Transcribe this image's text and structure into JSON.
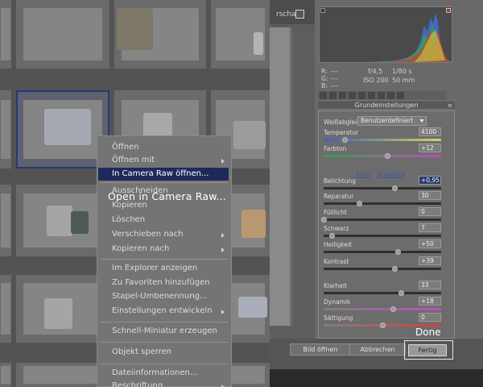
{
  "context_menu": {
    "items": [
      {
        "label": "Öffnen",
        "has_submenu": false
      },
      {
        "label": "Öffnen mit",
        "has_submenu": true
      },
      {
        "label": "In Camera Raw öffnen...",
        "has_submenu": false,
        "highlighted": true
      },
      {
        "label": "Ausschneiden",
        "has_submenu": false
      },
      {
        "label": "Kopieren",
        "has_submenu": false
      },
      {
        "label": "Löschen",
        "has_submenu": false
      },
      {
        "label": "Verschieben nach",
        "has_submenu": true
      },
      {
        "label": "Kopieren nach",
        "has_submenu": true
      },
      {
        "label": "Im Explorer anzeigen",
        "has_submenu": false
      },
      {
        "label": "Zu Favoriten hinzufügen",
        "has_submenu": false
      },
      {
        "label": "Stapel-Umbenennung...",
        "has_submenu": false
      },
      {
        "label": "Einstellungen entwickeln",
        "has_submenu": true
      },
      {
        "label": "Schnell-Miniatur erzeugen",
        "has_submenu": false
      },
      {
        "label": "Objekt sperren",
        "has_submenu": false
      },
      {
        "label": "Dateiinformationen...",
        "has_submenu": false
      },
      {
        "label": "Beschriftung",
        "has_submenu": true
      }
    ]
  },
  "annotations": {
    "open_in_camera_raw": "Open in Camera Raw...",
    "done": "Done"
  },
  "dialog": {
    "left_tab": "rschau",
    "histogram_info": {
      "r_label": "R:",
      "r_value": "---",
      "g_label": "G:",
      "g_value": "---",
      "b_label": "B:",
      "b_value": "---",
      "aperture": "f/4,5",
      "shutter": "1/80 s",
      "iso": "ISO 200",
      "focal": "50 mm"
    },
    "section_title": "Grundeinstellungen",
    "white_balance": {
      "label": "Weißabgleich:",
      "value": "Benutzerdefiniert"
    },
    "links": {
      "auto": "Auto",
      "standard": "Standard"
    },
    "sliders": [
      {
        "label": "Temperatur",
        "value": "4100",
        "level": 0.18
      },
      {
        "label": "Farbton",
        "value": "+12",
        "level": 0.54
      },
      {
        "label": "Belichtung",
        "value": "+0,95",
        "level": 0.6,
        "active": true
      },
      {
        "label": "Reparatur",
        "value": "30",
        "level": 0.3
      },
      {
        "label": "Fülllicht",
        "value": "0",
        "level": 0.0
      },
      {
        "label": "Schwarz",
        "value": "7",
        "level": 0.07
      },
      {
        "label": "Helligkeit",
        "value": "+50",
        "level": 0.63
      },
      {
        "label": "Kontrast",
        "value": "+39",
        "level": 0.6
      },
      {
        "label": "Klarheit",
        "value": "33",
        "level": 0.66
      },
      {
        "label": "Dynamik",
        "value": "+18",
        "level": 0.59
      },
      {
        "label": "Sättigung",
        "value": "0",
        "level": 0.5
      }
    ],
    "buttons": {
      "open_image": "Bild öffnen",
      "cancel": "Abbrechen",
      "done": "Fertig"
    }
  },
  "colors": {
    "menu_highlight": "#1e2a5c",
    "active_field": "#2a3a6e",
    "link": "#3d56a8"
  }
}
